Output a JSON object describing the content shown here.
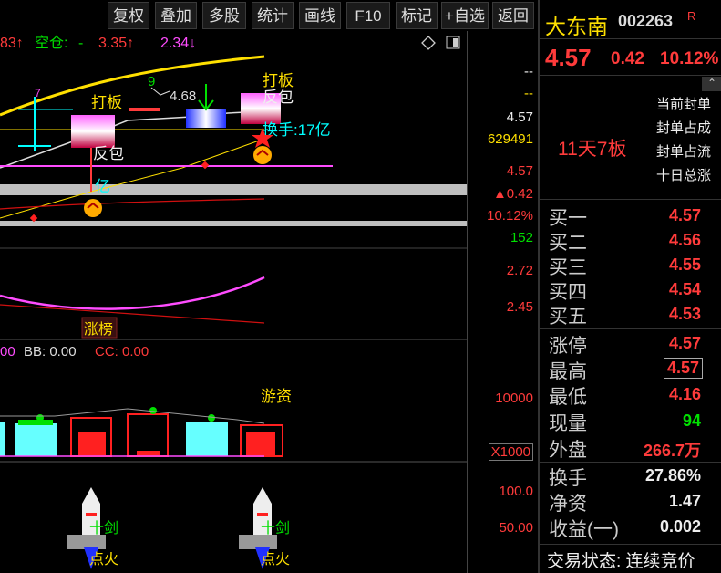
{
  "toolbar": {
    "buttons": [
      "复权",
      "叠加",
      "多股",
      "统计",
      "画线",
      "F10",
      "标记",
      "+自选",
      "返回"
    ]
  },
  "stock": {
    "name": "大东南",
    "code": "002263",
    "code_suffix": "R",
    "price": "4.57",
    "change": "0.42",
    "change_pct": "10.12%"
  },
  "streak": "11天7板",
  "seal_info": [
    "当前封单",
    "封单占成",
    "封单占流",
    "十日总涨"
  ],
  "order_book": [
    {
      "label": "买一",
      "value": "4.57"
    },
    {
      "label": "买二",
      "value": "4.56"
    },
    {
      "label": "买三",
      "value": "4.55"
    },
    {
      "label": "买四",
      "value": "4.54"
    },
    {
      "label": "买五",
      "value": "4.53"
    }
  ],
  "stats": [
    {
      "label": "涨停",
      "value": "4.57"
    },
    {
      "label": "最高",
      "value": "4.57"
    },
    {
      "label": "最低",
      "value": "4.16"
    },
    {
      "label": "现量",
      "value": "94"
    },
    {
      "label": "外盘",
      "value": "266.7万"
    }
  ],
  "metrics": [
    {
      "label": "换手",
      "value": "27.86%"
    },
    {
      "label": "净资",
      "value": "1.47"
    },
    {
      "label": "收益(一)",
      "value": "0.002"
    }
  ],
  "trade_state": "交易状态: 连续竞价",
  "chart": {
    "top_indicator": {
      "prefix": "83↑",
      "kong": "空仓:",
      "dash": "-",
      "v1": "3.35↑",
      "v2": "2.34↓"
    },
    "mid_indicator": {
      "a": "00",
      "bb": "BB: 0.00",
      "cc": "CC: 0.00"
    },
    "annotations": {
      "daban1": "打板",
      "daban2": "打板",
      "fanbao1": "反包",
      "fanbao2": "反包",
      "num9": "9",
      "price468": "4.68",
      "seven": "7",
      "huanshou": "换手:17亿",
      "yiyi": "亿",
      "zhangbang": "涨榜",
      "youzi": "游资",
      "shijian1": "十剑",
      "shijian2": "十剑",
      "dianhuo1": "点火",
      "dianhuo2": "点火"
    },
    "axis": {
      "dash1": "--",
      "dash2": "--",
      "price": "4.57",
      "volume": "629491",
      "price2": "4.57",
      "chg": "▲0.42",
      "pct": "10.12%",
      "vol2": "152",
      "y272": "2.72",
      "y245": "2.45",
      "y10000": "10000",
      "x1000": "X1000",
      "y100": "100.0",
      "y50": "50.00"
    }
  },
  "colors": {
    "up": "#ff3b3b",
    "down": "#00e000",
    "accent": "#ffe000",
    "cyan": "#00ffff",
    "magenta": "#ff4cff"
  }
}
